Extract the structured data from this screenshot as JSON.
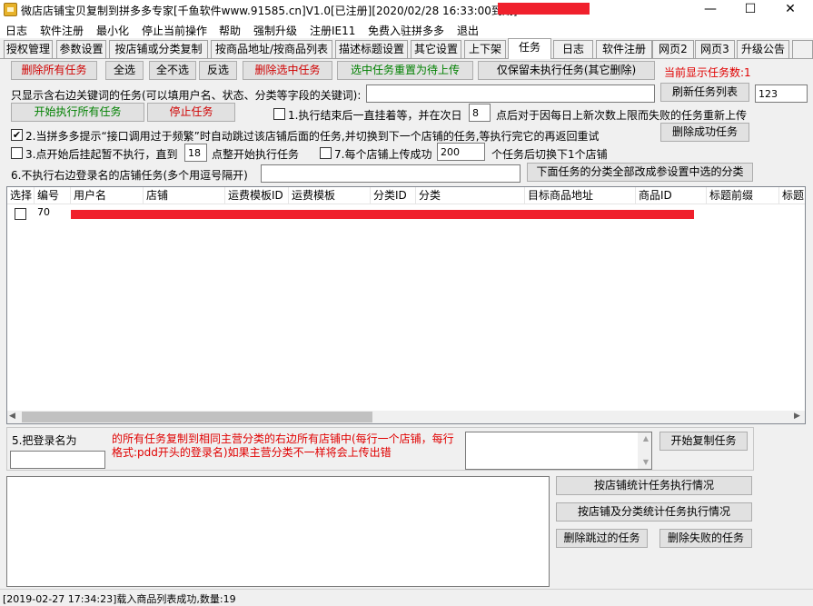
{
  "window": {
    "title": "微店店铺宝贝复制到拼多多专家[千鱼软件www.91585.cn]V1.0[已注册][2020/02/28 16:33:00到期]",
    "min_glyph": "—",
    "max_glyph": "☐",
    "close_glyph": "✕"
  },
  "menu": [
    "日志",
    "软件注册",
    "最小化",
    "停止当前操作",
    "帮助",
    "强制升级",
    "注册IE11",
    "免费入驻拼多多",
    "退出"
  ],
  "tabs": [
    "授权管理",
    "参数设置",
    "按店铺或分类复制",
    "按商品地址/按商品列表",
    "描述标题设置",
    "其它设置",
    "上下架",
    "任务",
    "日志",
    "软件注册",
    "网页2",
    "网页3",
    "升级公告"
  ],
  "active_tab": "任务",
  "toolbar": {
    "delete_all": "删除所有任务",
    "select_all": "全选",
    "select_none": "全不选",
    "invert": "反选",
    "delete_selected": "删除选中任务",
    "reset_selected": "选中任务重置为待上传",
    "keep_unexecuted": "仅保留未执行任务(其它删除)",
    "current_count": "当前显示任务数:1"
  },
  "filter": {
    "label": "只显示含右边关键词的任务(可以填用户名、状态、分类等字段的关键词):",
    "value": "",
    "refresh": "刷新任务列表",
    "side_value": "123"
  },
  "run": {
    "start_all": "开始执行所有任务",
    "stop": "停止任务",
    "opt1_label_a": "1.执行结束后一直挂着等，并在次日",
    "opt1_value": "8",
    "opt1_label_b": "点后对于因每日上新次数上限而失败的任务重新上传",
    "opt1_checked": false
  },
  "opt2": {
    "label": "2.当拼多多提示“接口调用过于频繁”时自动跳过该店铺后面的任务,并切换到下一个店铺的任务,等执行完它的再返回重试",
    "checked": true,
    "delete_success": "删除成功任务"
  },
  "opt3": {
    "label_a": "3.点开始后挂起暂不执行，直到",
    "value": "18",
    "label_b": "点整开始执行任务",
    "checked": false
  },
  "opt7": {
    "label_a": "7.每个店铺上传成功",
    "value": "200",
    "label_b": "个任务后切换下1个店铺",
    "checked": false
  },
  "opt6": {
    "label": "6.不执行右边登录名的店铺任务(多个用逗号隔开)",
    "value": "",
    "change_category": "下面任务的分类全部改成参设置中选的分类"
  },
  "grid": {
    "columns": [
      "选择",
      "编号",
      "用户名",
      "店铺",
      "运费模板ID",
      "运费模板",
      "分类ID",
      "分类",
      "目标商品地址",
      "商品ID",
      "标题前缀",
      "标题"
    ],
    "rows": [
      {
        "checked": false,
        "id": "70"
      }
    ]
  },
  "copy": {
    "label": "5.把登录名为",
    "input_value": "",
    "desc": "的所有任务复制到相同主营分类的右边所有店铺中(每行一个店铺，每行格式:pdd开头的登录名)如果主营分类不一样将会上传出错",
    "start": "开始复制任务"
  },
  "stats": {
    "by_shop": "按店铺统计任务执行情况",
    "by_shop_cat": "按店铺及分类统计任务执行情况",
    "delete_skipped": "删除跳过的任务",
    "delete_failed": "删除失败的任务"
  },
  "status": "[2019-02-27 17:34:23]载入商品列表成功,数量:19"
}
